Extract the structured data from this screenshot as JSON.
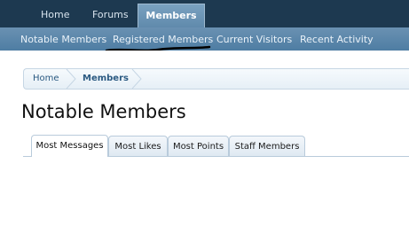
{
  "nav": {
    "tabs": [
      {
        "label": "Home"
      },
      {
        "label": "Forums"
      },
      {
        "label": "Members",
        "active": true
      }
    ]
  },
  "subnav": {
    "links": [
      {
        "label": "Notable Members"
      },
      {
        "label": "Registered Members"
      },
      {
        "label": "Current Visitors"
      },
      {
        "label": "Recent Activity"
      }
    ]
  },
  "breadcrumb": {
    "items": [
      {
        "label": "Home"
      },
      {
        "label": "Members"
      }
    ]
  },
  "page": {
    "title": "Notable Members"
  },
  "tabs": [
    {
      "label": "Most Messages",
      "active": true
    },
    {
      "label": "Most Likes"
    },
    {
      "label": "Most Points"
    },
    {
      "label": "Staff Members"
    }
  ],
  "colors": {
    "top_bar": "#1d3950",
    "sub_bar": "#5884a8",
    "link": "#2b5a82"
  }
}
